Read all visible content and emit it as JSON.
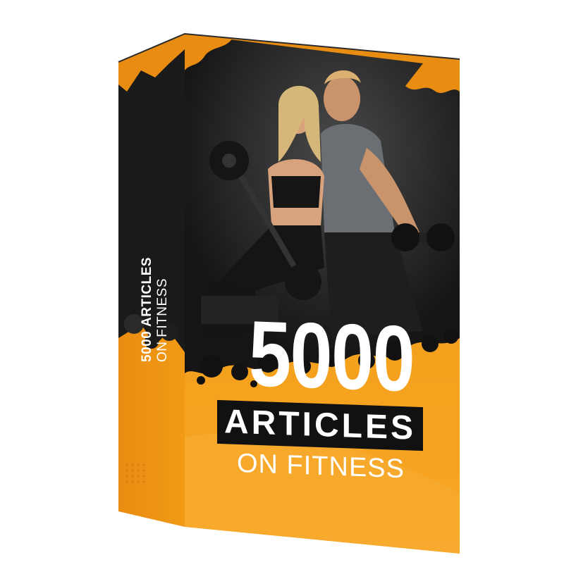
{
  "product": {
    "spine_count": "5000",
    "spine_title": "ARTICLES",
    "spine_subtitle": "ON FITNESS",
    "front_count": "5000",
    "front_title": "ARTICLES",
    "front_subtitle": "ON FITNESS"
  },
  "colors": {
    "accent_orange": "#F7A21B",
    "accent_orange_dark": "#E8870F",
    "box_dark": "#1c1c1c",
    "photo_bg": "#2a2a2a",
    "text": "#ffffff"
  },
  "image": {
    "subject_icon": "couple-with-dumbbells-photo"
  }
}
